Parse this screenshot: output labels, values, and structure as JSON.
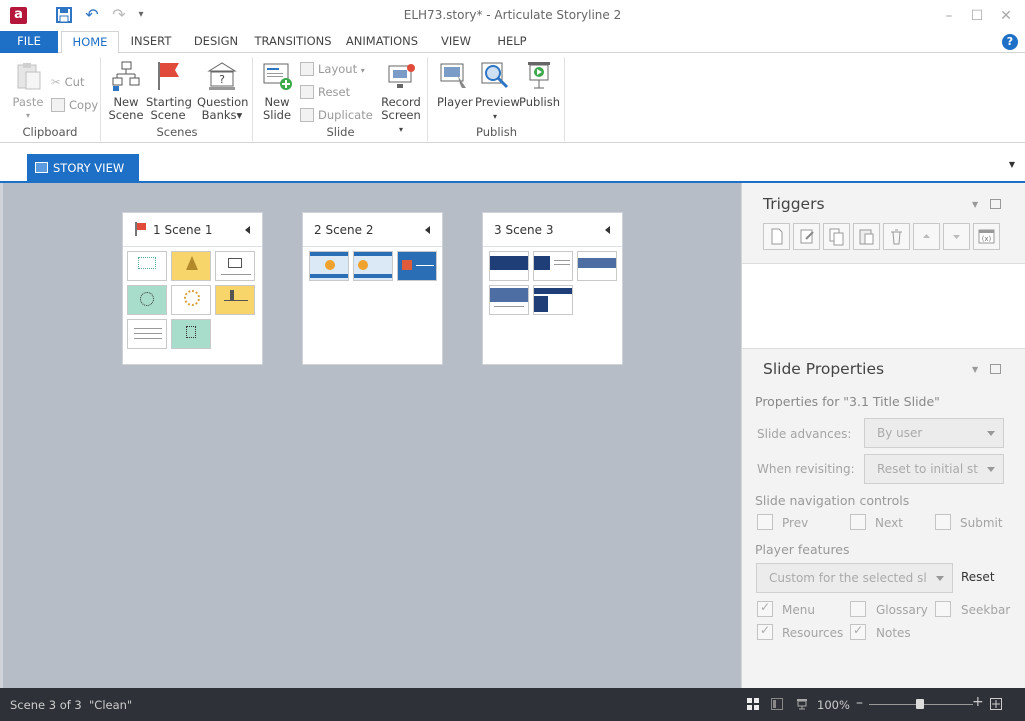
{
  "window": {
    "title": "ELH73.story* - Articulate Storyline 2",
    "logo_letter": "a"
  },
  "ribbon_tabs": [
    "FILE",
    "HOME",
    "INSERT",
    "DESIGN",
    "TRANSITIONS",
    "ANIMATIONS",
    "VIEW",
    "HELP"
  ],
  "ribbon": {
    "clipboard": {
      "paste": "Paste",
      "cut": "Cut",
      "copy": "Copy",
      "label": "Clipboard"
    },
    "scenes": {
      "new_scene": [
        "New",
        "Scene"
      ],
      "starting_scene": [
        "Starting",
        "Scene"
      ],
      "question_banks": [
        "Question",
        "Banks"
      ],
      "label": "Scenes"
    },
    "slide": {
      "new_slide": [
        "New",
        "Slide"
      ],
      "layout": "Layout",
      "reset": "Reset",
      "duplicate": "Duplicate",
      "record_screen": [
        "Record",
        "Screen"
      ],
      "label": "Slide"
    },
    "publish": {
      "player": "Player",
      "preview": "Preview",
      "publish": "Publish",
      "label": "Publish"
    }
  },
  "view_tab": {
    "label": "STORY VIEW"
  },
  "scenes": [
    {
      "title": "1 Scene 1",
      "starting": true,
      "slide_count": 8
    },
    {
      "title": "2 Scene 2",
      "starting": false,
      "slide_count": 3
    },
    {
      "title": "3 Scene 3",
      "starting": false,
      "slide_count": 5
    }
  ],
  "triggers": {
    "title": "Triggers",
    "toolbar_icons": [
      "new-trigger-icon",
      "edit-trigger-icon",
      "copy-trigger-icon",
      "paste-trigger-icon",
      "delete-trigger-icon",
      "move-up-icon",
      "move-down-icon",
      "variables-icon"
    ]
  },
  "slide_properties": {
    "title": "Slide Properties",
    "properties_for": "Properties for \"3.1 Title Slide\"",
    "slide_advances_label": "Slide advances:",
    "slide_advances_value": "By user",
    "when_revisiting_label": "When revisiting:",
    "when_revisiting_value": "Reset to initial st",
    "nav_controls_heading": "Slide navigation controls",
    "nav_controls": [
      {
        "label": "Prev",
        "checked": false
      },
      {
        "label": "Next",
        "checked": false
      },
      {
        "label": "Submit",
        "checked": false
      }
    ],
    "player_features_heading": "Player features",
    "player_features_value": "Custom for the selected sl",
    "reset_label": "Reset",
    "player_features": [
      {
        "label": "Menu",
        "checked": true
      },
      {
        "label": "Glossary",
        "checked": false
      },
      {
        "label": "Seekbar",
        "checked": false
      },
      {
        "label": "Resources",
        "checked": true
      },
      {
        "label": "Notes",
        "checked": true
      }
    ]
  },
  "statusbar": {
    "scene_position": "Scene 3 of 3",
    "theme": "\"Clean\"",
    "zoom": "100%"
  },
  "colors": {
    "accent": "#1e6fc6",
    "canvas": "#b7bdc6",
    "statusbar": "#2e3138"
  }
}
